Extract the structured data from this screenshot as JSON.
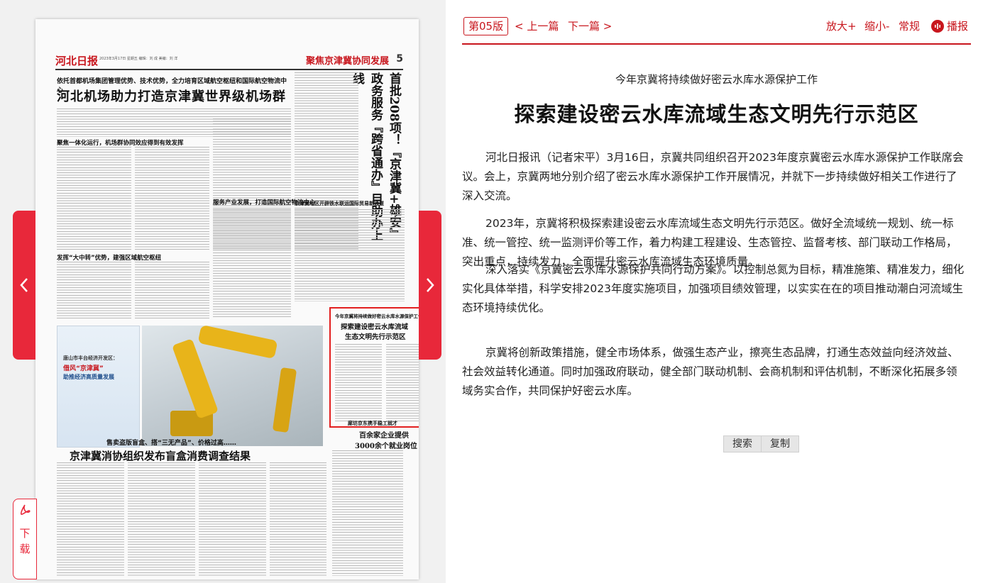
{
  "newspaper": {
    "logo": "河北日报",
    "masthead_meta": "2023年3月17日 星期五  编辑：刘 成  美编：刘 洋",
    "section_title": "聚焦京津冀协同发展",
    "page_number": "5",
    "lead_subtitle": "依托首都机场集团管理优势、技术优势，全力培育区域航空枢纽和国际航空物流中心",
    "lead_title": "河北机场助力打造京津冀世界级机场群",
    "vertical_headline": "首批208项！『京津冀+雄安』政务服务『跨省通办』目助办上线",
    "headings": [
      "聚焦一体化运行，机场群协同效应得到有效发挥",
      "发挥“大中转”优势，建强区域航空枢纽",
      "服务产业发展，打造国际航空物流中心",
      "京津冀地区开辟铁水联运国际贸易新通道"
    ],
    "ad": {
      "line1": "唐山市丰台经济开发区：",
      "line2": "借风“京津冀”",
      "line3": "助推经济高质量发展"
    },
    "highlight": {
      "line1": "今年京冀将持续做好密云水库水源保护工作",
      "line2": "探索建设密云水库流域",
      "line3": "生态文明先行示范区"
    },
    "bottom_subtitle": "售卖盗版盲盒、搭“三无产品”、价格过高……",
    "bottom_title": "京津冀消协组织发布盲盒消费调查结果",
    "right_bottom_subtitle": "廊坊京东携手稳工就才",
    "right_bottom_title_1": "百余家企业提供",
    "right_bottom_title_2": "3000余个就业岗位"
  },
  "left_nav": {
    "download_icon": "pdf-icon",
    "download_label": "下载"
  },
  "toolbar": {
    "page_badge": "第05版",
    "prev_article": "< 上一篇",
    "next_article": "下一篇 >",
    "zoom_in": "放大+",
    "zoom_out": "缩小-",
    "normal": "常规",
    "play": "播报"
  },
  "article": {
    "subtitle": "今年京冀将持续做好密云水库水源保护工作",
    "title": "探索建设密云水库流域生态文明先行示范区",
    "paragraphs": [
      "河北日报讯（记者宋平）3月16日，京冀共同组织召开2023年度京冀密云水库水源保护工作联席会议。会上，京冀两地分别介绍了密云水库水源保护工作开展情况，并就下一步持续做好相关工作进行了深入交流。",
      "2023年，京冀将积极探索建设密云水库流域生态文明先行示范区。做好全流域统一规划、统一标准、统一管控、统一监测评价等工作，着力构建工程建设、生态管控、监督考核、部门联动工作格局，突出重点，持续发力，全面提升密云水库流域生态环境质量。",
      "深入落实《京冀密云水库水源保护共同行动方案》。以控制总氮为目标，精准施策、精准发力，细化实化具体举措，科学安排2023年度实施项目，加强项目绩效管理，以实实在在的项目推动潮白河流域生态环境持续优化。",
      "京冀将创新政策措施，健全市场体系，做强生态产业，擦亮生态品牌，打通生态效益向经济效益、社会效益转化通道。同时加强政府联动，健全部门联动机制、会商机制和评估机制，不断深化拓展多领域务实合作，共同保护好密云水库。"
    ]
  },
  "actions": {
    "search": "搜索",
    "copy": "复制"
  },
  "colors": {
    "brand_red": "#c8161d",
    "tab_red": "#e8283a",
    "highlight_border": "#e21f1f"
  }
}
